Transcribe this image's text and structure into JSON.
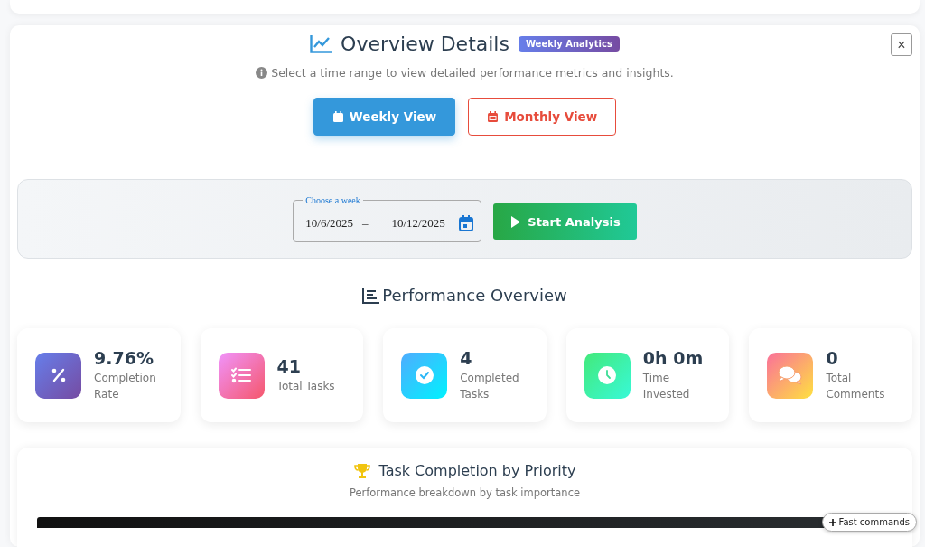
{
  "header": {
    "title": "Overview Details",
    "badge": "Weekly Analytics",
    "close": "×",
    "hint": "Select a time range to view detailed performance metrics and insights."
  },
  "view_buttons": [
    {
      "label": "Weekly View",
      "selected": true,
      "color": "#3498db"
    },
    {
      "label": "Monthly View",
      "selected": false,
      "color": "#e74c3c"
    }
  ],
  "week_picker": {
    "legend": "Choose a week",
    "start": "10/6/2025",
    "separator": "–",
    "end": "10/12/2025"
  },
  "start_button": {
    "label": "Start Analysis"
  },
  "performance": {
    "title": "Performance Overview"
  },
  "stats": [
    {
      "kind": "percent",
      "value": "9.76%",
      "label": "Completion Rate"
    },
    {
      "kind": "list",
      "value": "41",
      "label": "Total Tasks"
    },
    {
      "kind": "check",
      "value": "4",
      "label": "Completed Tasks"
    },
    {
      "kind": "clock",
      "value": "0h 0m",
      "label": "Time Invested"
    },
    {
      "kind": "comments",
      "value": "0",
      "label": "Total Comments"
    }
  ],
  "priority": {
    "title": "Task Completion by Priority",
    "subtitle": "Performance breakdown by task importance"
  },
  "fast_commands": {
    "label": "Fast commands"
  }
}
